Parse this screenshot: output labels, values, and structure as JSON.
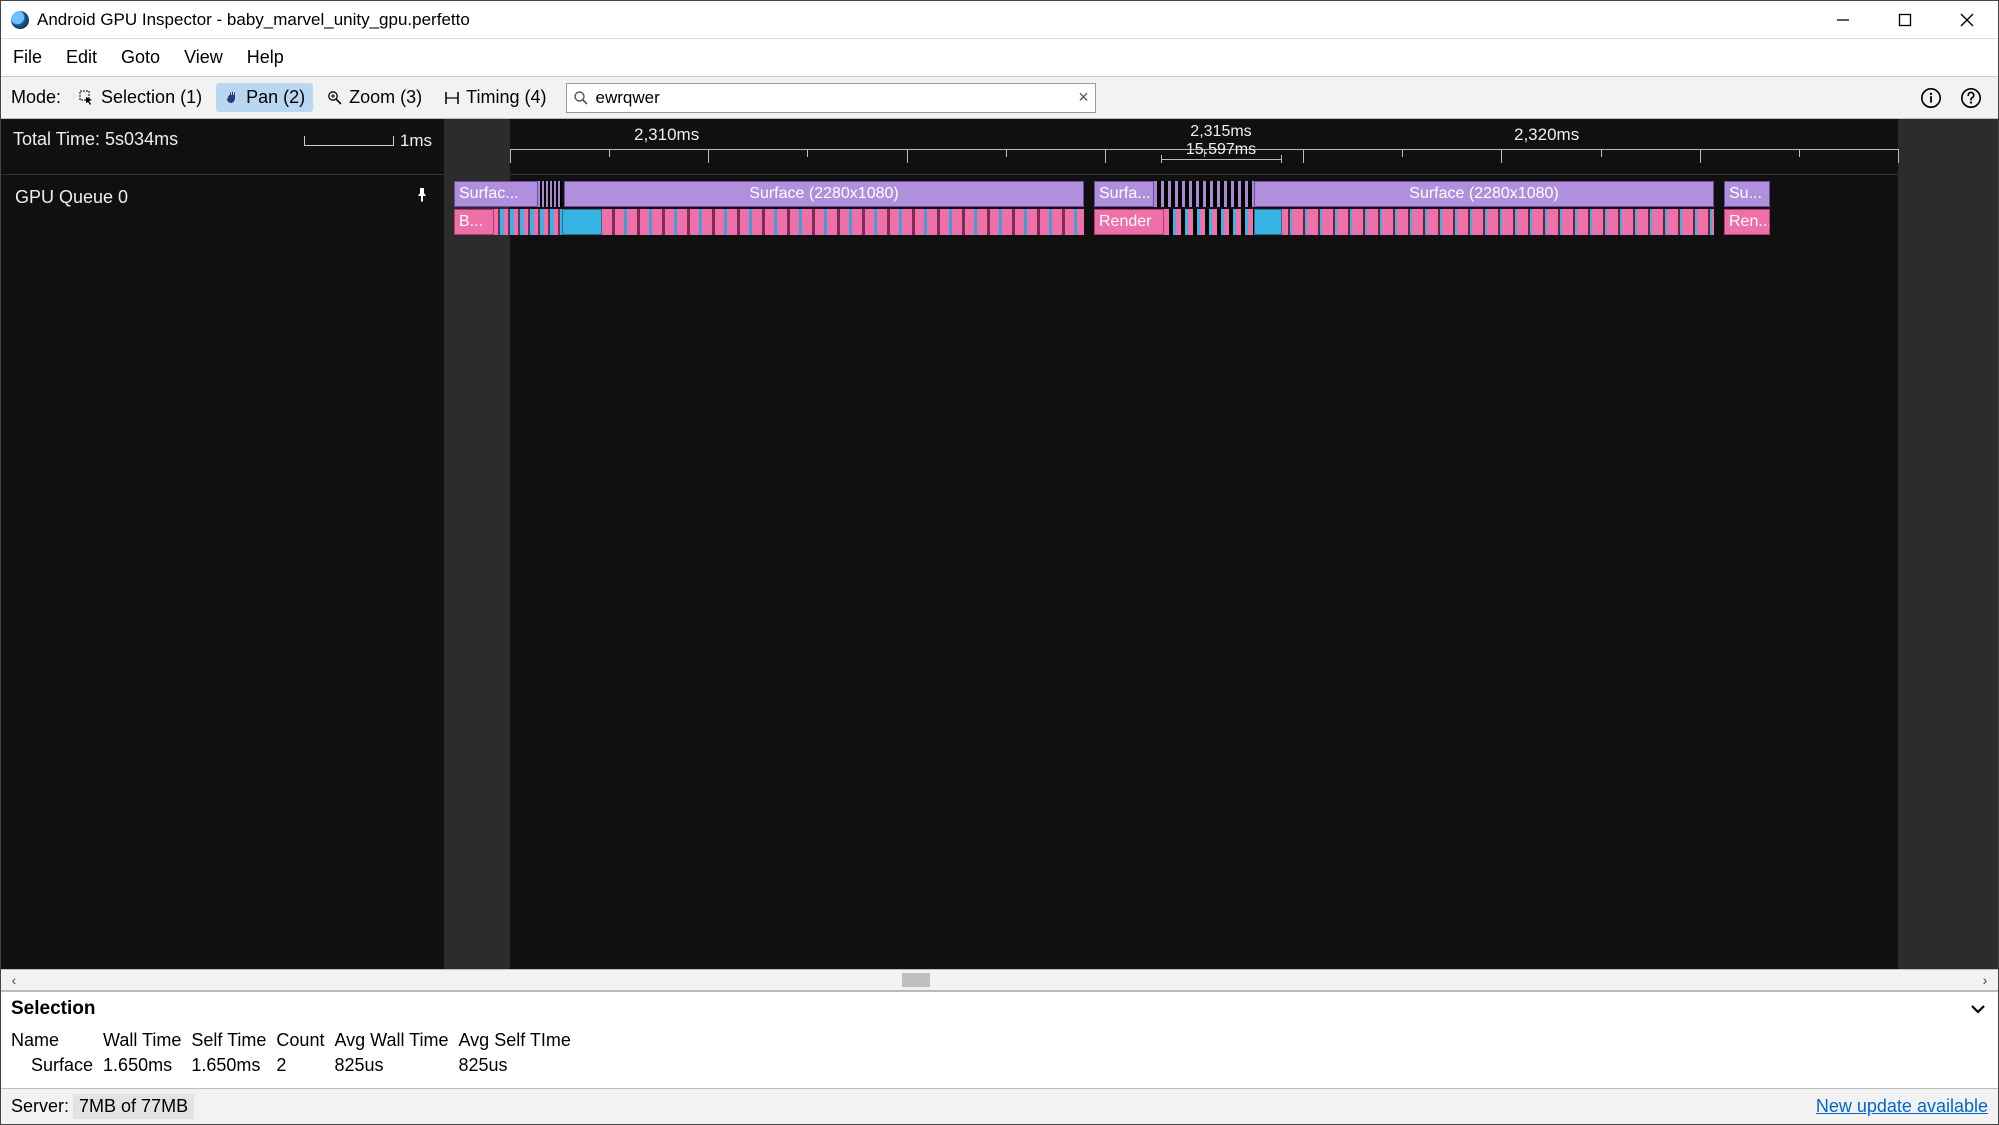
{
  "window": {
    "title": "Android GPU Inspector - baby_marvel_unity_gpu.perfetto"
  },
  "menu": {
    "items": [
      "File",
      "Edit",
      "Goto",
      "View",
      "Help"
    ]
  },
  "toolbar": {
    "mode_label": "Mode:",
    "modes": [
      {
        "label": "Selection (1)",
        "icon": "selection"
      },
      {
        "label": "Pan (2)",
        "icon": "pan",
        "active": true
      },
      {
        "label": "Zoom (3)",
        "icon": "zoom"
      },
      {
        "label": "Timing (4)",
        "icon": "timing"
      }
    ],
    "search_value": "ewrqwer"
  },
  "timeline": {
    "total_time": "Total Time: 5s034ms",
    "scale_label": "1ms",
    "track_name": "GPU Queue 0",
    "ruler_labels": {
      "l1": "2,310ms",
      "mid_top": "2,315ms",
      "mid_len": "15.597ms",
      "l2": "2,320ms"
    },
    "surfaces": {
      "a": "Surfac...",
      "b": "Surface (2280x1080)",
      "c": "Surfa...",
      "d": "Surface (2280x1080)",
      "e": "Su..."
    },
    "renders": {
      "a": "B...",
      "b": "Render",
      "c": "Ren..."
    }
  },
  "selection": {
    "title": "Selection",
    "headers": [
      "Name",
      "Wall Time",
      "Self Time",
      "Count",
      "Avg Wall Time",
      "Avg Self TIme"
    ],
    "row": {
      "name": "Surface",
      "wall": "1.650ms",
      "self": "1.650ms",
      "count": "2",
      "avgwall": "825us",
      "avgself": "825us"
    }
  },
  "status": {
    "server_label": "Server:",
    "memory": "7MB of 77MB",
    "update": "New update available"
  }
}
